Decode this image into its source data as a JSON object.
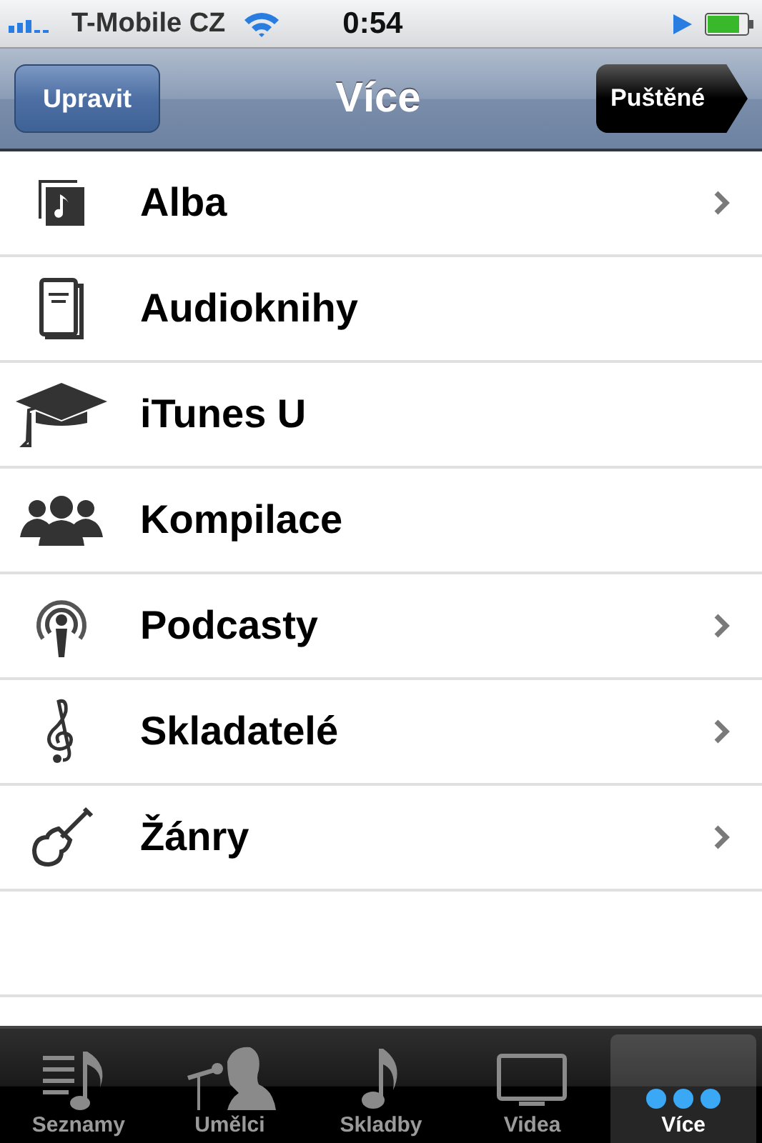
{
  "status_bar": {
    "carrier": "T-Mobile CZ",
    "time": "0:54"
  },
  "nav_bar": {
    "left_button": "Upravit",
    "title": "Více",
    "right_button": "Puštěné"
  },
  "items": [
    {
      "kind": "album",
      "label": "Alba",
      "chevron": true
    },
    {
      "kind": "audiobook",
      "label": "Audioknihy",
      "chevron": false
    },
    {
      "kind": "cap",
      "label": "iTunes U",
      "chevron": false
    },
    {
      "kind": "people",
      "label": "Kompilace",
      "chevron": false
    },
    {
      "kind": "podcast",
      "label": "Podcasty",
      "chevron": true
    },
    {
      "kind": "clef",
      "label": "Skladatelé",
      "chevron": true
    },
    {
      "kind": "guitar",
      "label": "Žánry",
      "chevron": true
    }
  ],
  "tab_bar": [
    {
      "kind": "playlists",
      "label": "Seznamy",
      "selected": false
    },
    {
      "kind": "artists",
      "label": "Umělci",
      "selected": false
    },
    {
      "kind": "songs",
      "label": "Skladby",
      "selected": false
    },
    {
      "kind": "videos",
      "label": "Videa",
      "selected": false
    },
    {
      "kind": "more",
      "label": "Více",
      "selected": true
    }
  ]
}
